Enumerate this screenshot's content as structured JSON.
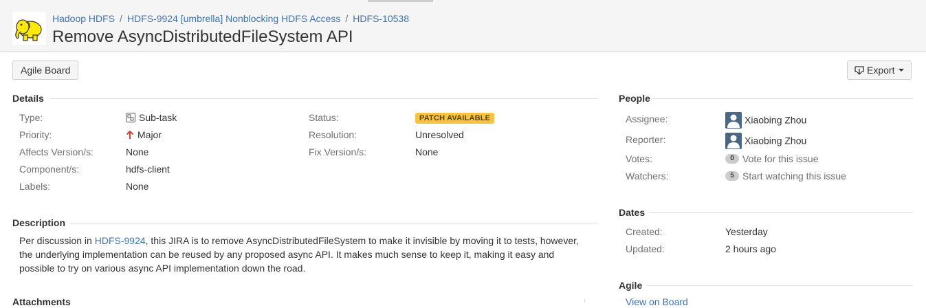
{
  "breadcrumbs": [
    "Hadoop HDFS",
    "HDFS-9924 [umbrella] Nonblocking HDFS Access",
    "HDFS-10538"
  ],
  "breadcrumb_sep": "/",
  "summary": "Remove AsyncDistributedFileSystem API",
  "toolbar": {
    "agile_board_label": "Agile Board",
    "export_label": "Export"
  },
  "details": {
    "title": "Details",
    "left": [
      {
        "label": "Type:",
        "value": "Sub-task",
        "icon": "subtask-icon"
      },
      {
        "label": "Priority:",
        "value": "Major",
        "icon": "priority-major-arrow-up-icon"
      },
      {
        "label": "Affects Version/s:",
        "value": "None"
      },
      {
        "label": "Component/s:",
        "value": "hdfs-client"
      },
      {
        "label": "Labels:",
        "value": "None"
      }
    ],
    "right": [
      {
        "label": "Status:",
        "value": "Patch Available"
      },
      {
        "label": "Resolution:",
        "value": "Unresolved"
      },
      {
        "label": "Fix Version/s:",
        "value": "None"
      }
    ]
  },
  "description": {
    "title": "Description",
    "prefix": "Per discussion in ",
    "link_text": "HDFS-9924",
    "suffix": ", this JIRA is to remove AsyncDistributedFileSystem to make it invisible by moving it to tests, however, the underlying implementation can be reused by any proposed async API. It makes much sense to keep it, making it easy and possible to try on various async API implementation down the road."
  },
  "attachments_title": "Attachments",
  "people": {
    "title": "People",
    "assignee_label": "Assignee:",
    "assignee": "Xiaobing Zhou",
    "reporter_label": "Reporter:",
    "reporter": "Xiaobing Zhou",
    "votes_label": "Votes:",
    "votes_count": "0",
    "votes_link": "Vote for this issue",
    "watchers_label": "Watchers:",
    "watchers_count": "5",
    "watchers_link": "Start watching this issue"
  },
  "dates": {
    "title": "Dates",
    "created_label": "Created:",
    "created": "Yesterday",
    "updated_label": "Updated:",
    "updated": "2 hours ago"
  },
  "agile": {
    "title": "Agile",
    "link": "View on Board"
  },
  "colors": {
    "link": "#3b73af",
    "lozenge": "#f6c342",
    "priority_major": "#d04437",
    "header_bg": "#f5f5f5"
  }
}
